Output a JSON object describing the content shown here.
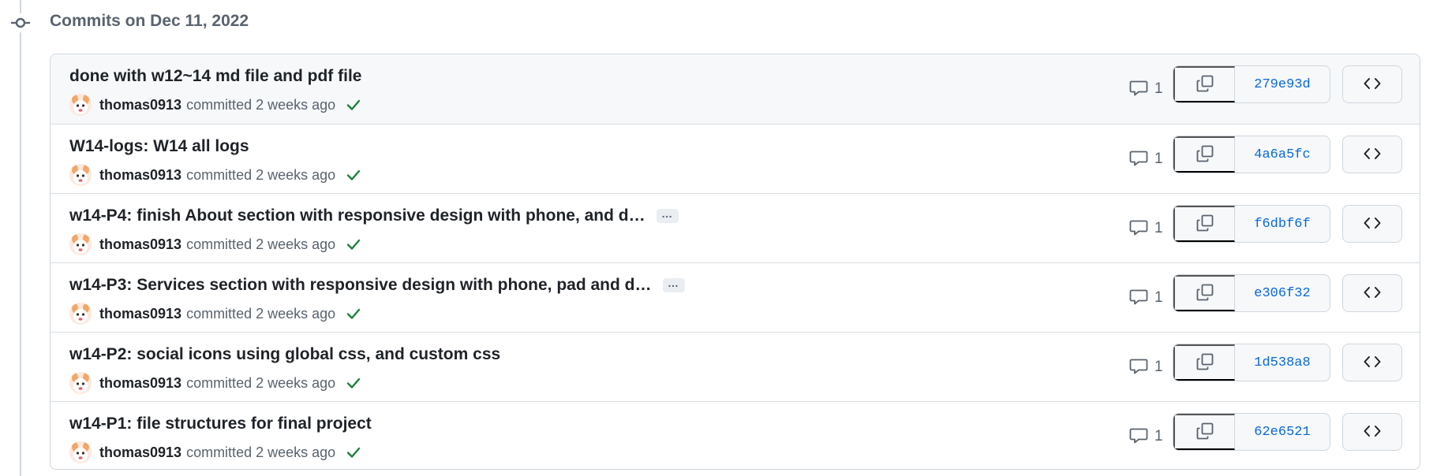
{
  "day": {
    "title": "Commits on Dec 11, 2022"
  },
  "colors": {
    "border": "#d0d7de",
    "muted_text": "#59636e",
    "link": "#0969da",
    "success": "#1a7f37",
    "header_bg": "#f6f8fa"
  },
  "icons": {
    "timeline": "git-commit-icon",
    "comment": "comment-icon",
    "copy": "copy-icon",
    "browse": "code-icon",
    "status": "check-icon",
    "more": "kebab-horizontal-icon"
  },
  "commits": [
    {
      "title": "done with w12~14 md file and pdf file",
      "author": "thomas0913",
      "meta": "committed 2 weeks ago",
      "comments": "1",
      "sha": "279e93d",
      "truncated": false
    },
    {
      "title": "W14-logs: W14 all logs",
      "author": "thomas0913",
      "meta": "committed 2 weeks ago",
      "comments": "1",
      "sha": "4a6a5fc",
      "truncated": false
    },
    {
      "title": "w14-P4: finish About section with responsive design with phone, and d…",
      "author": "thomas0913",
      "meta": "committed 2 weeks ago",
      "comments": "1",
      "sha": "f6dbf6f",
      "truncated": true,
      "ellipsis": "…"
    },
    {
      "title": "w14-P3: Services section with responsive design with phone, pad and d…",
      "author": "thomas0913",
      "meta": "committed 2 weeks ago",
      "comments": "1",
      "sha": "e306f32",
      "truncated": true,
      "ellipsis": "…"
    },
    {
      "title": "w14-P2: social icons using global css, and custom css",
      "author": "thomas0913",
      "meta": "committed 2 weeks ago",
      "comments": "1",
      "sha": "1d538a8",
      "truncated": false
    },
    {
      "title": "w14-P1: file structures for final project",
      "author": "thomas0913",
      "meta": "committed 2 weeks ago",
      "comments": "1",
      "sha": "62e6521",
      "truncated": false
    }
  ]
}
